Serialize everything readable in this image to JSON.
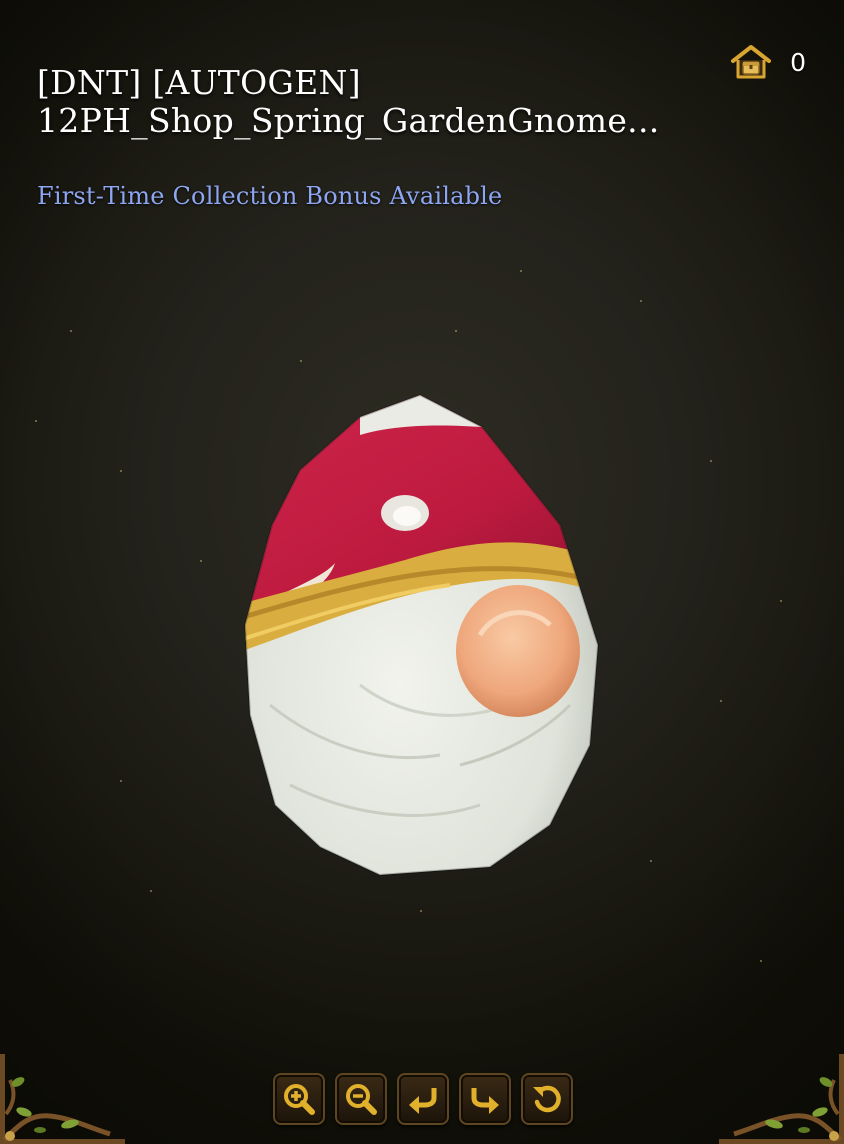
{
  "item": {
    "title_line1": "[DNT] [AUTOGEN]",
    "title_line2": "12PH_Shop_Spring_GardenGnome...",
    "bonus_text": "First-Time Collection Bonus Available"
  },
  "house_counter": {
    "icon": "house-chest-icon",
    "count": "0"
  },
  "model_preview": {
    "subject": "garden gnome egg"
  },
  "controls": [
    {
      "icon": "zoom-in-icon"
    },
    {
      "icon": "zoom-out-icon"
    },
    {
      "icon": "rotate-left-icon"
    },
    {
      "icon": "rotate-right-icon"
    },
    {
      "icon": "reset-view-icon"
    }
  ],
  "colors": {
    "title": "#ffffff",
    "bonus": "#8ea6f2",
    "gold_accent": "#e2b12b",
    "background": "#23221b"
  }
}
